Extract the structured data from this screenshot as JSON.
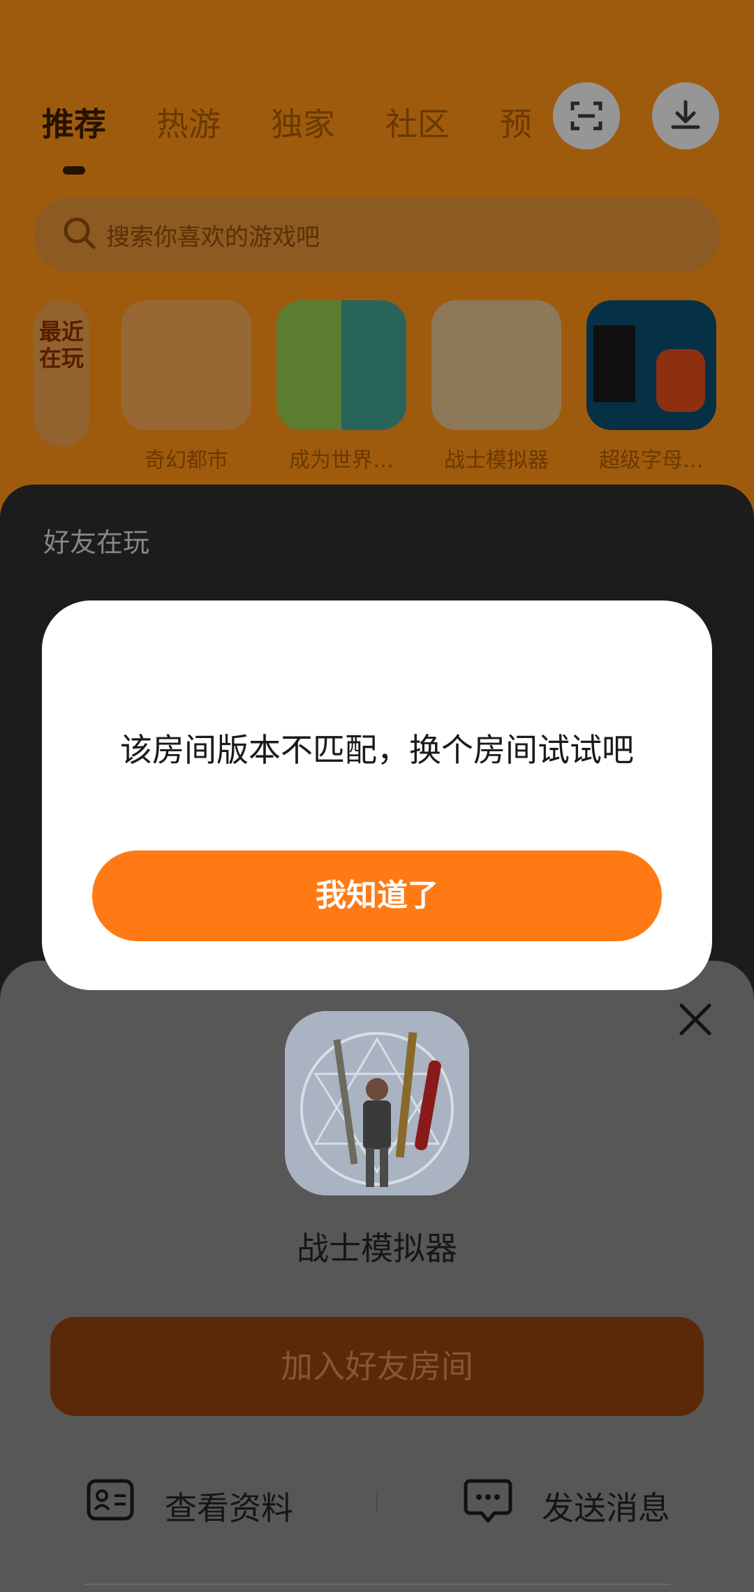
{
  "header": {
    "tabs": [
      {
        "label": "推荐",
        "active": true
      },
      {
        "label": "热游",
        "active": false
      },
      {
        "label": "独家",
        "active": false
      },
      {
        "label": "社区",
        "active": false
      },
      {
        "label": "预",
        "active": false
      }
    ],
    "scan_icon": "scan-icon",
    "download_icon": "download-icon"
  },
  "search": {
    "placeholder": "搜索你喜欢的游戏吧"
  },
  "recent": {
    "tag": "最近在玩",
    "games": [
      {
        "name": "奇幻都市"
      },
      {
        "name": "成为世界…"
      },
      {
        "name": "战士模拟器"
      },
      {
        "name": "超级字母…"
      }
    ]
  },
  "friends": {
    "title": "好友在玩"
  },
  "sheet": {
    "game_name": "战士模拟器",
    "join_label": "加入好友房间",
    "view_profile_label": "查看资料",
    "send_message_label": "发送消息"
  },
  "dialog": {
    "message": "该房间版本不匹配，换个房间试试吧",
    "ok_label": "我知道了"
  },
  "colors": {
    "accent": "#ff7a14",
    "background": "#f48c14",
    "sheet": "#575757",
    "dialog": "#ffffff"
  }
}
